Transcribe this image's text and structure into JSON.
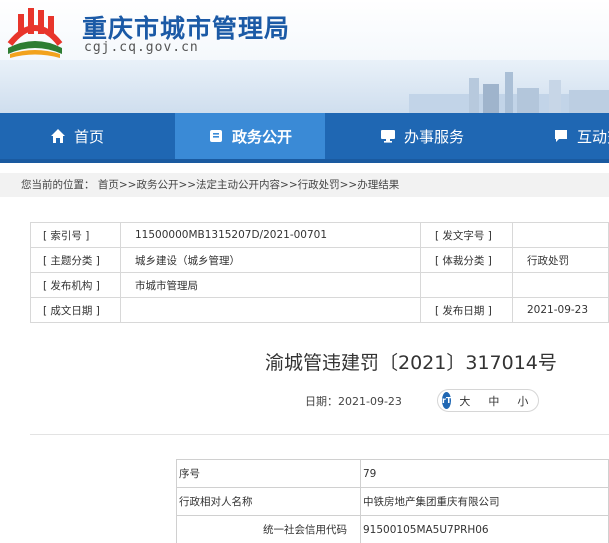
{
  "header": {
    "site_title": "重庆市城市管理局",
    "site_url": "cgj.cq.gov.cn"
  },
  "nav": {
    "items": [
      {
        "label": "首页",
        "icon": "home-icon"
      },
      {
        "label": "政务公开",
        "icon": "document-icon",
        "active": true
      },
      {
        "label": "办事服务",
        "icon": "service-icon"
      },
      {
        "label": "互动交",
        "icon": "chat-icon"
      }
    ]
  },
  "breadcrumb": {
    "prefix": "您当前的位置：",
    "path": "首页>>政务公开>>法定主动公开内容>>行政处罚>>办理结果"
  },
  "meta": {
    "rows": [
      {
        "l1": "[ 索引号 ]",
        "v1": "11500000MB1315207D/2021-00701",
        "l2": "[ 发文字号 ]",
        "v2": ""
      },
      {
        "l1": "[ 主题分类 ]",
        "v1": "城乡建设（城乡管理）",
        "l2": "[ 体裁分类 ]",
        "v2": "行政处罚"
      },
      {
        "l1": "[ 发布机构 ]",
        "v1": "市城市管理局",
        "l2": "",
        "v2": ""
      },
      {
        "l1": "[ 成文日期 ]",
        "v1": "",
        "l2": "[ 发布日期 ]",
        "v2": "2021-09-23"
      }
    ]
  },
  "document": {
    "title": "渝城管违建罚〔2021〕317014号",
    "date_label": "日期：",
    "date": "2021-09-23",
    "font_sizes": [
      "大",
      "中",
      "小"
    ]
  },
  "content": {
    "rows": [
      {
        "key": "序号",
        "value": "79"
      },
      {
        "key": "行政相对人名称",
        "value": "中铁房地产集团重庆有限公司"
      },
      {
        "key": "统一社会信用代码",
        "value": "91500105MA5U7PRH06",
        "sub": true
      }
    ]
  },
  "colors": {
    "nav_bg": "#1f67b3",
    "nav_active": "#3a8ad6",
    "title_blue": "#1b5aa6"
  }
}
